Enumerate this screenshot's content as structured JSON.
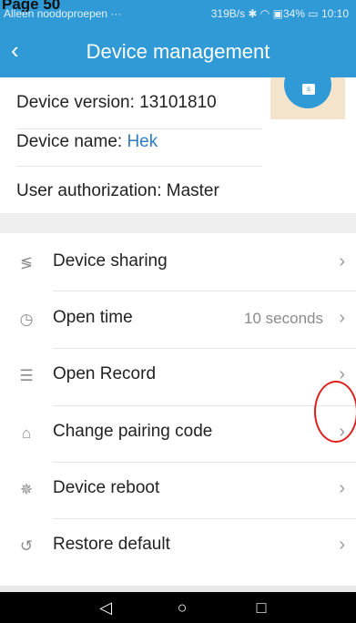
{
  "status_bar": {
    "doc_label": "Page 50",
    "carrier": "Alleen noodoproepen ···",
    "right": "319B/s ✱ ◠ ▣34% ▭ 10:10"
  },
  "header": {
    "title": "Device management",
    "back_icon": "chevron-left-icon"
  },
  "device_info": {
    "version_label": "Device version: 13101810",
    "name_label": "Device name: ",
    "name_value": "Hek",
    "authorization_label": "User authorization: Master"
  },
  "menu": {
    "items": [
      {
        "label": "Device sharing",
        "icon": "share-icon",
        "value": ""
      },
      {
        "label": "Open time",
        "icon": "clock-icon",
        "value": "10 seconds"
      },
      {
        "label": "Open Record",
        "icon": "record-icon",
        "value": ""
      },
      {
        "label": "Change pairing code",
        "icon": "lock-icon",
        "value": ""
      },
      {
        "label": "Device reboot",
        "icon": "reboot-icon",
        "value": ""
      },
      {
        "label": "Restore default",
        "icon": "restore-icon",
        "value": ""
      }
    ]
  },
  "colors": {
    "accent": "#2f9ad6",
    "link": "#2f7dc3",
    "annotation": "#e01e1e"
  }
}
